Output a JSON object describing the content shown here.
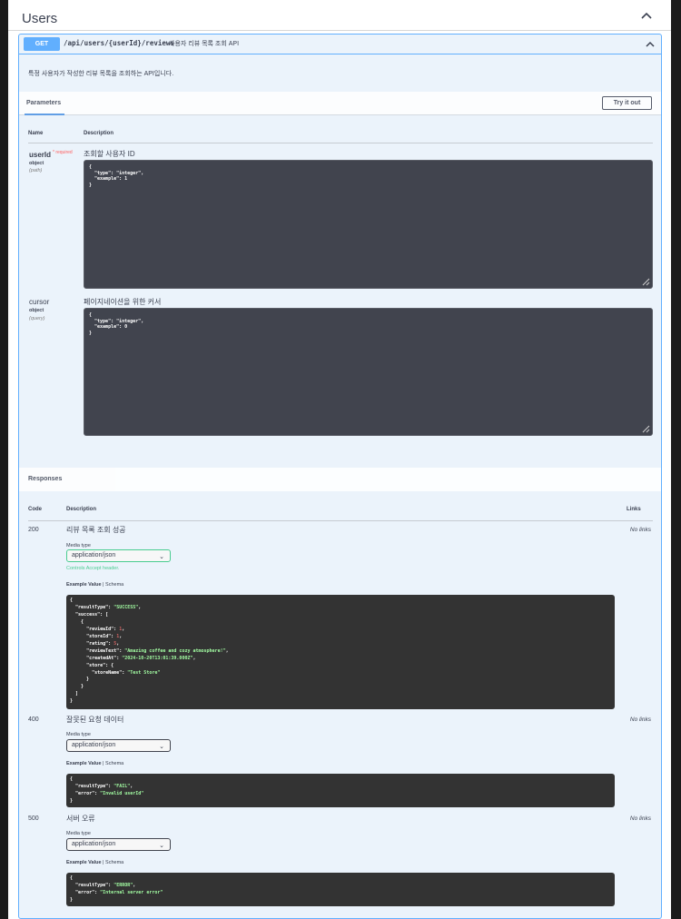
{
  "tag": {
    "title": "Users"
  },
  "operation": {
    "method": "GET",
    "path": "/api/users/{userId}/reviews",
    "summary": "사용자 리뷰 목록 조회 API",
    "description": "특정 사용자가 작성한 리뷰 목록을 조회하는 API입니다."
  },
  "parameters": {
    "tab_label": "Parameters",
    "try_label": "Try it out",
    "col_name": "Name",
    "col_description": "Description",
    "required_label": "* required",
    "items": [
      {
        "name": "userId",
        "type": "object",
        "in": "(path)",
        "description": "조회할 사용자 ID",
        "value": "{\n  \"type\": \"integer\",\n  \"example\": 1\n}"
      },
      {
        "name": "cursor",
        "type": "object",
        "in": "(query)",
        "description": "페이지네이션을 위한 커서",
        "value": "{\n  \"type\": \"integer\",\n  \"example\": 0\n}"
      }
    ]
  },
  "responses": {
    "title": "Responses",
    "col_code": "Code",
    "col_description": "Description",
    "col_links": "Links",
    "media_type_label": "Media type",
    "accept_label": "Controls Accept header.",
    "example_value_label": "Example Value",
    "schema_label": "Schema",
    "items": [
      {
        "code": "200",
        "description": "리뷰 목록 조회 성공",
        "links": "No links",
        "media_type": "application/json"
      },
      {
        "code": "400",
        "description": "잘못된 요청 데이터",
        "links": "No links",
        "media_type": "application/json"
      },
      {
        "code": "500",
        "description": "서버 오류",
        "links": "No links",
        "media_type": "application/json"
      }
    ]
  },
  "colors": {
    "get": "#61affe",
    "accent_green": "#49cc90",
    "required": "#ff6060"
  },
  "icons": [
    "chevron-up-icon",
    "resize-handle-icon",
    "chevron-down-icon"
  ]
}
